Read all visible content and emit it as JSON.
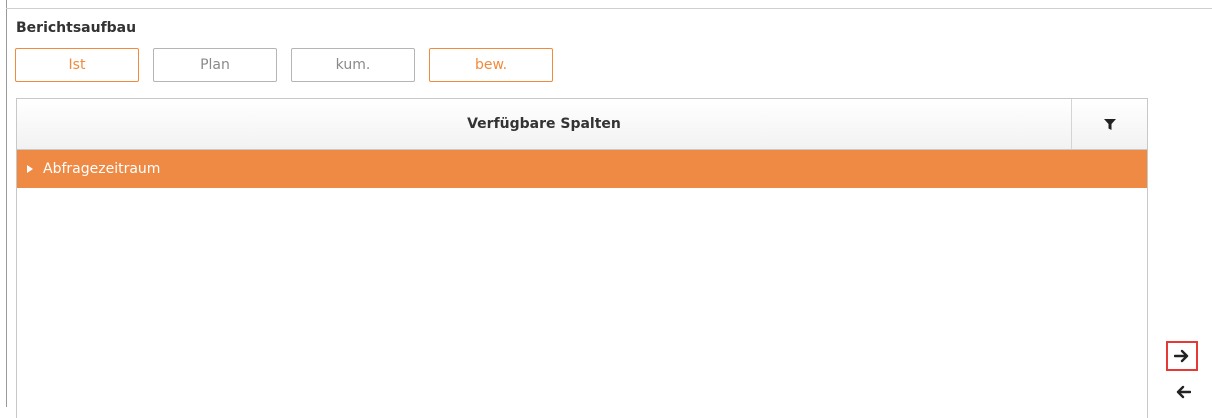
{
  "section": {
    "title": "Berichtsaufbau"
  },
  "toggles": [
    {
      "label": "Ist",
      "active": true
    },
    {
      "label": "Plan",
      "active": false
    },
    {
      "label": "kum.",
      "active": false
    },
    {
      "label": "bew.",
      "active": true
    }
  ],
  "grid": {
    "header_title": "Verfügbare Spalten",
    "filter_icon": "filter-icon",
    "group_row_label": "Abfragezeitraum"
  },
  "transfer": {
    "move_right_icon": "arrow-right-icon",
    "move_left_icon": "arrow-left-icon"
  },
  "colors": {
    "accent": "#f08a3c",
    "group_row": "#ef8a45",
    "highlight_border": "#e53935"
  }
}
